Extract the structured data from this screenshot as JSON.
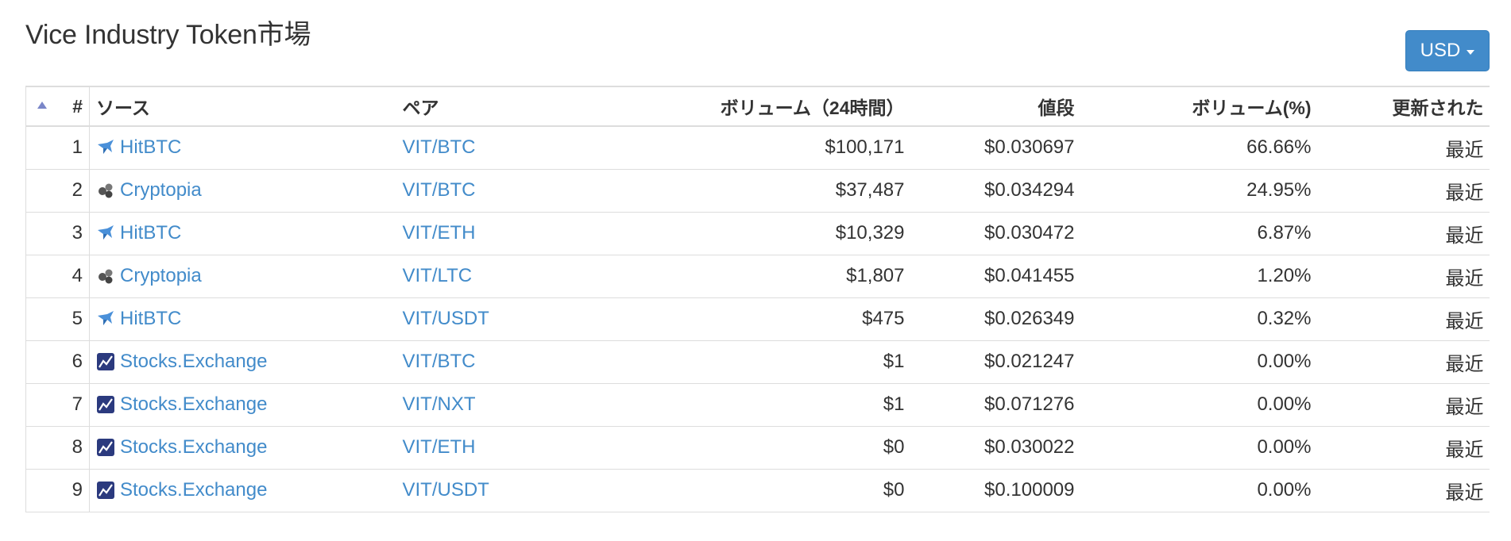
{
  "page": {
    "title": "Vice Industry Token市場"
  },
  "currency": {
    "selected": "USD"
  },
  "table": {
    "headers": {
      "num": "#",
      "source": "ソース",
      "pair": "ペア",
      "volume": "ボリューム（24時間）",
      "price": "値段",
      "volume_pct": "ボリューム(%)",
      "updated": "更新された"
    },
    "rows": [
      {
        "num": "1",
        "source": "HitBTC",
        "icon": "hitbtc-icon",
        "pair": "VIT/BTC",
        "volume": "$100,171",
        "price": "$0.030697",
        "volume_pct": "66.66%",
        "updated": "最近"
      },
      {
        "num": "2",
        "source": "Cryptopia",
        "icon": "cryptopia-icon",
        "pair": "VIT/BTC",
        "volume": "$37,487",
        "price": "$0.034294",
        "volume_pct": "24.95%",
        "updated": "最近"
      },
      {
        "num": "3",
        "source": "HitBTC",
        "icon": "hitbtc-icon",
        "pair": "VIT/ETH",
        "volume": "$10,329",
        "price": "$0.030472",
        "volume_pct": "6.87%",
        "updated": "最近"
      },
      {
        "num": "4",
        "source": "Cryptopia",
        "icon": "cryptopia-icon",
        "pair": "VIT/LTC",
        "volume": "$1,807",
        "price": "$0.041455",
        "volume_pct": "1.20%",
        "updated": "最近"
      },
      {
        "num": "5",
        "source": "HitBTC",
        "icon": "hitbtc-icon",
        "pair": "VIT/USDT",
        "volume": "$475",
        "price": "$0.026349",
        "volume_pct": "0.32%",
        "updated": "最近"
      },
      {
        "num": "6",
        "source": "Stocks.Exchange",
        "icon": "stocks-exchange-icon",
        "pair": "VIT/BTC",
        "volume": "$1",
        "price": "$0.021247",
        "volume_pct": "0.00%",
        "updated": "最近"
      },
      {
        "num": "7",
        "source": "Stocks.Exchange",
        "icon": "stocks-exchange-icon",
        "pair": "VIT/NXT",
        "volume": "$1",
        "price": "$0.071276",
        "volume_pct": "0.00%",
        "updated": "最近"
      },
      {
        "num": "8",
        "source": "Stocks.Exchange",
        "icon": "stocks-exchange-icon",
        "pair": "VIT/ETH",
        "volume": "$0",
        "price": "$0.030022",
        "volume_pct": "0.00%",
        "updated": "最近"
      },
      {
        "num": "9",
        "source": "Stocks.Exchange",
        "icon": "stocks-exchange-icon",
        "pair": "VIT/USDT",
        "volume": "$0",
        "price": "$0.100009",
        "volume_pct": "0.00%",
        "updated": "最近"
      }
    ]
  },
  "colors": {
    "link": "#428bca",
    "button": "#428bca",
    "border": "#dddddd"
  }
}
